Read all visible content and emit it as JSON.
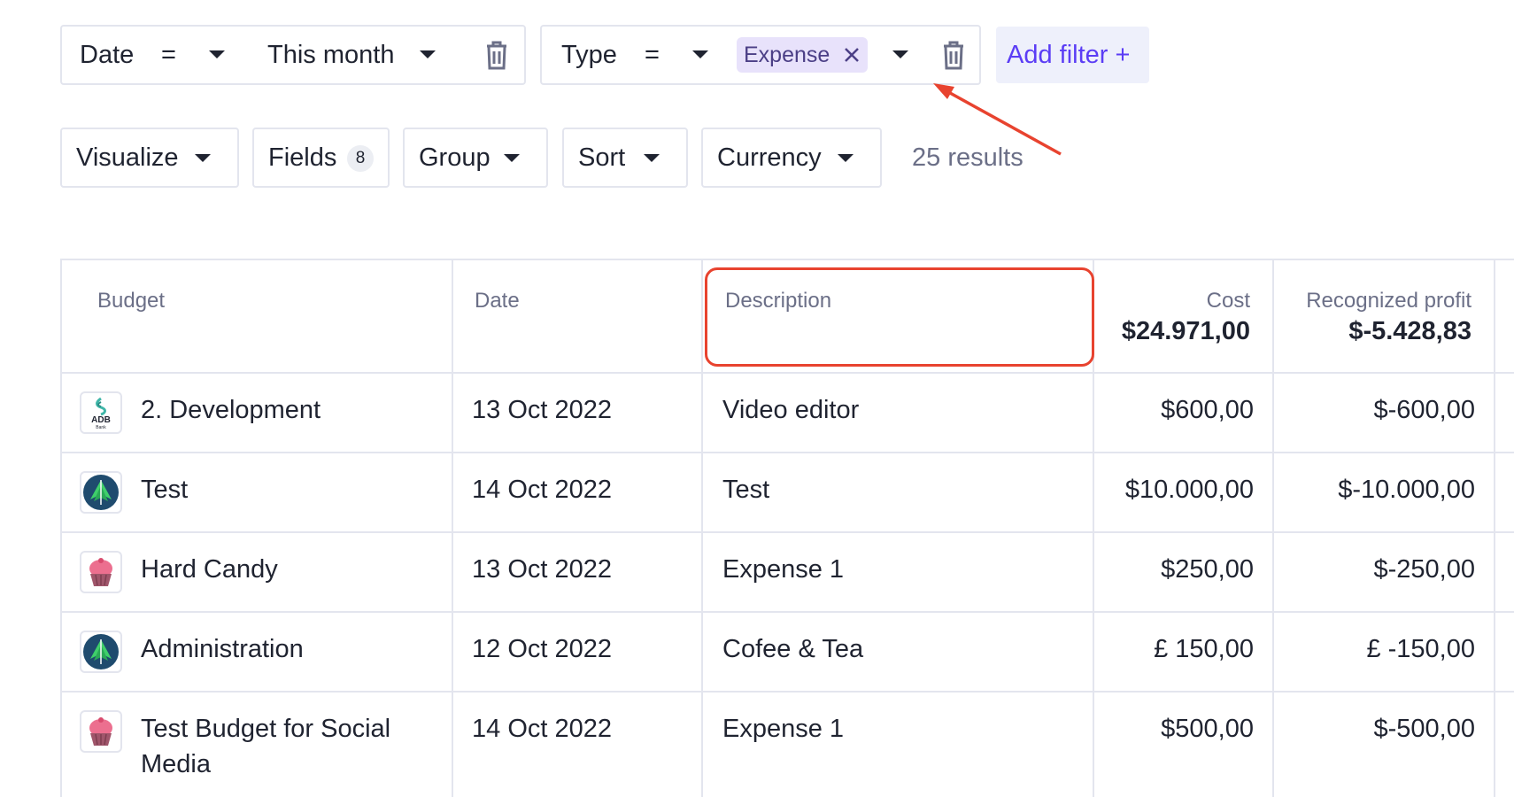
{
  "filters": [
    {
      "field": "Date",
      "operator": "=",
      "value": "This month"
    },
    {
      "field": "Type",
      "operator": "=",
      "chip": "Expense"
    }
  ],
  "add_filter_label": "Add filter +",
  "toolbar": {
    "visualize": "Visualize",
    "fields": "Fields",
    "fields_count": "8",
    "group": "Group",
    "sort": "Sort",
    "currency": "Currency",
    "results": "25 results"
  },
  "table": {
    "headers": {
      "budget": "Budget",
      "date": "Date",
      "description": "Description",
      "cost": "Cost",
      "profit": "Recognized profit"
    },
    "totals": {
      "cost": "$24.971,00",
      "profit": "$-5.428,83"
    },
    "rows": [
      {
        "budget": "2. Development",
        "avatar": "adb-bank-logo",
        "date": "13 Oct 2022",
        "description": "Video editor",
        "cost": "$600,00",
        "profit": "$-600,00"
      },
      {
        "budget": "Test",
        "avatar": "tree-circle-logo",
        "date": "14 Oct 2022",
        "description": "Test",
        "cost": "$10.000,00",
        "profit": "$-10.000,00"
      },
      {
        "budget": "Hard Candy",
        "avatar": "cupcake-logo",
        "date": "13 Oct 2022",
        "description": "Expense 1",
        "cost": "$250,00",
        "profit": "$-250,00"
      },
      {
        "budget": "Administration",
        "avatar": "tree-circle-logo",
        "date": "12 Oct 2022",
        "description": "Cofee & Tea",
        "cost": "£ 150,00",
        "profit": "£ -150,00"
      },
      {
        "budget": "Test Budget for Social",
        "budget_line2": "Media",
        "avatar": "cupcake-logo",
        "date": "14 Oct 2022",
        "description": "Expense 1",
        "cost": "$500,00",
        "profit": "$-500,00"
      }
    ],
    "avatar_lettering": {
      "adb": "ADB",
      "bank": "Bank"
    }
  },
  "colors": {
    "accent": "#5b3df5",
    "annotation": "#e8432f",
    "chip_bg": "#e8e2fb",
    "border": "#e3e5ee"
  }
}
